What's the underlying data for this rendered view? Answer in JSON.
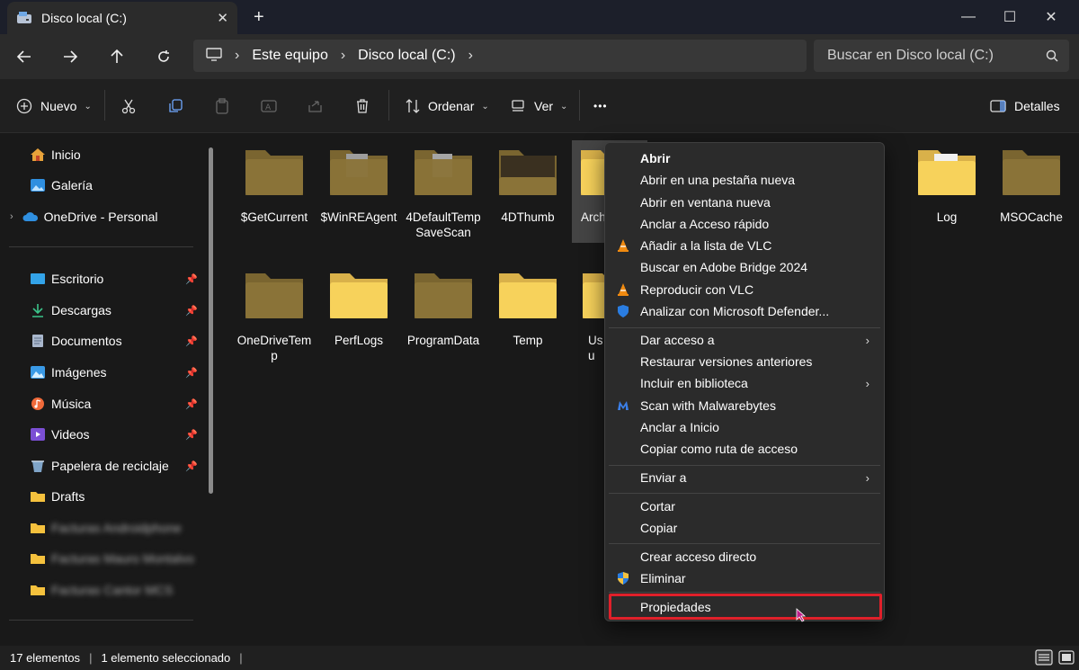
{
  "window": {
    "tab_title": "Disco local (C:)",
    "tab_close": "✕",
    "new_tab": "+",
    "controls": {
      "minimize": "—",
      "maximize": "☐",
      "close": "✕"
    }
  },
  "address": {
    "crumbs": [
      "Este equipo",
      "Disco local (C:)"
    ],
    "separator": "›"
  },
  "search": {
    "placeholder": "Buscar en Disco local (C:)"
  },
  "toolbar": {
    "new_label": "Nuevo",
    "sort_label": "Ordenar",
    "view_label": "Ver",
    "more_label": "•••",
    "details_label": "Detalles"
  },
  "sidebar": {
    "items": [
      {
        "label": "Inicio",
        "icon": "home-icon"
      },
      {
        "label": "Galería",
        "icon": "gallery-icon"
      },
      {
        "label": "OneDrive - Personal",
        "icon": "cloud-icon"
      },
      {
        "label": "Escritorio",
        "icon": "desktop-icon"
      },
      {
        "label": "Descargas",
        "icon": "download-icon"
      },
      {
        "label": "Documentos",
        "icon": "document-icon"
      },
      {
        "label": "Imágenes",
        "icon": "images-icon"
      },
      {
        "label": "Música",
        "icon": "music-icon"
      },
      {
        "label": "Videos",
        "icon": "video-icon"
      },
      {
        "label": "Papelera de reciclaje",
        "icon": "recycle-bin-icon"
      },
      {
        "label": "Drafts",
        "icon": "folder-icon"
      },
      {
        "label": "Facturas Androidphone",
        "icon": "folder-icon"
      },
      {
        "label": "Facturas Mauro Montalvo",
        "icon": "folder-icon"
      },
      {
        "label": "Facturas Cantor MCS",
        "icon": "folder-icon"
      }
    ]
  },
  "folders": [
    {
      "name": "$GetCurrent"
    },
    {
      "name": "$WinREAgent"
    },
    {
      "name": "4DefaultTempSaveScan"
    },
    {
      "name": "4DThumb"
    },
    {
      "name": "Arch…pro"
    },
    {
      "name": "Log"
    },
    {
      "name": "MSOCache"
    },
    {
      "name": "OneDriveTemp"
    },
    {
      "name": "PerfLogs"
    },
    {
      "name": "ProgramData"
    },
    {
      "name": "Temp"
    },
    {
      "name": "Usu"
    }
  ],
  "context_menu": {
    "items": [
      {
        "label": "Abrir"
      },
      {
        "label": "Abrir en una pestaña nueva"
      },
      {
        "label": "Abrir en ventana nueva"
      },
      {
        "label": "Anclar a Acceso rápido"
      },
      {
        "label": "Añadir a la lista de VLC"
      },
      {
        "label": "Buscar en Adobe Bridge 2024"
      },
      {
        "label": "Reproducir con VLC"
      },
      {
        "label": "Analizar con Microsoft Defender..."
      },
      {
        "label": "Dar acceso a"
      },
      {
        "label": "Restaurar versiones anteriores"
      },
      {
        "label": "Incluir en biblioteca"
      },
      {
        "label": "Scan with Malwarebytes"
      },
      {
        "label": "Anclar a Inicio"
      },
      {
        "label": "Copiar como ruta de acceso"
      },
      {
        "label": "Enviar a"
      },
      {
        "label": "Cortar"
      },
      {
        "label": "Copiar"
      },
      {
        "label": "Crear acceso directo"
      },
      {
        "label": "Eliminar"
      },
      {
        "label": "Propiedades"
      }
    ]
  },
  "status": {
    "count": "17 elementos",
    "selection": "1 elemento seleccionado"
  },
  "colors": {
    "folder_dim": "#8a7338",
    "folder_bright": "#f7d25b",
    "highlight": "#e0202a",
    "vlc": "#f08a10",
    "defender": "#2a7de1"
  }
}
